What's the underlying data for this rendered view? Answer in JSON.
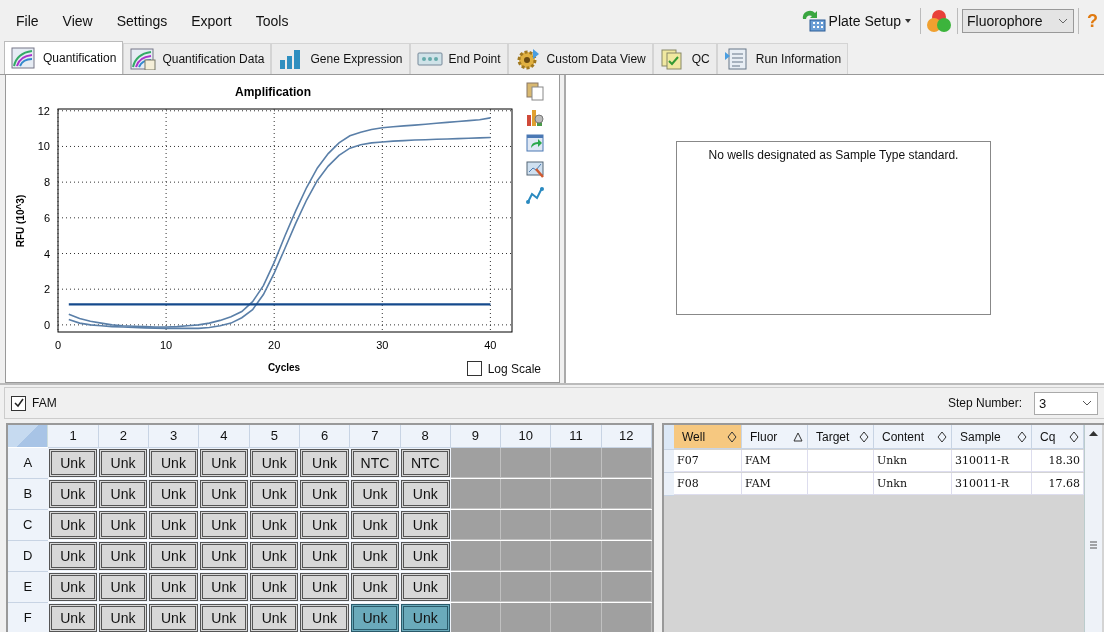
{
  "menu": [
    "File",
    "View",
    "Settings",
    "Export",
    "Tools"
  ],
  "toolbar": {
    "plate_setup": "Plate Setup",
    "fluorophore": "Fluorophore",
    "help": "?"
  },
  "tabs": [
    {
      "label": "Quantification",
      "selected": true
    },
    {
      "label": "Quantification Data",
      "selected": false
    },
    {
      "label": "Gene Expression",
      "selected": false
    },
    {
      "label": "End Point",
      "selected": false
    },
    {
      "label": "Custom Data View",
      "selected": false
    },
    {
      "label": "QC",
      "selected": false
    },
    {
      "label": "Run Information",
      "selected": false
    }
  ],
  "chart": {
    "log_scale": {
      "label": "Log Scale",
      "checked": false
    },
    "chart_data": {
      "type": "line",
      "title": "Amplification",
      "xlabel": "Cycles",
      "ylabel": "RFU (10^3)",
      "xlim": [
        0,
        42
      ],
      "ylim": [
        -0.4,
        12.1
      ],
      "xticks": [
        0,
        10,
        20,
        30,
        40
      ],
      "yticks": [
        0,
        2,
        4,
        6,
        8,
        10,
        12
      ],
      "x": [
        1,
        2,
        3,
        4,
        5,
        6,
        7,
        8,
        9,
        10,
        11,
        12,
        13,
        14,
        15,
        16,
        17,
        18,
        19,
        20,
        21,
        22,
        23,
        24,
        25,
        26,
        27,
        28,
        29,
        30,
        31,
        32,
        33,
        34,
        35,
        36,
        37,
        38,
        39,
        40
      ],
      "series": [
        {
          "color": "#5a7fa8",
          "values": [
            0.6,
            0.35,
            0.2,
            0.1,
            0.0,
            -0.05,
            -0.08,
            -0.1,
            -0.12,
            -0.12,
            -0.1,
            -0.05,
            0.0,
            0.1,
            0.25,
            0.45,
            0.75,
            1.3,
            2.2,
            3.5,
            5.0,
            6.4,
            7.7,
            8.8,
            9.6,
            10.2,
            10.6,
            10.8,
            10.95,
            11.05,
            11.1,
            11.15,
            11.2,
            11.25,
            11.3,
            11.35,
            11.4,
            11.45,
            11.5,
            11.6
          ]
        },
        {
          "color": "#5a7fa8",
          "values": [
            0.3,
            0.1,
            0.0,
            -0.05,
            -0.1,
            -0.12,
            -0.15,
            -0.17,
            -0.18,
            -0.2,
            -0.2,
            -0.2,
            -0.2,
            -0.15,
            -0.05,
            0.1,
            0.4,
            0.85,
            1.7,
            2.9,
            4.3,
            5.7,
            7.0,
            8.1,
            8.9,
            9.5,
            9.9,
            10.1,
            10.2,
            10.25,
            10.3,
            10.33,
            10.36,
            10.38,
            10.4,
            10.42,
            10.44,
            10.46,
            10.48,
            10.5
          ]
        },
        {
          "color": "#154a8c",
          "values": [
            1.15,
            1.15,
            1.15,
            1.15,
            1.15,
            1.15,
            1.15,
            1.15,
            1.15,
            1.15,
            1.15,
            1.15,
            1.15,
            1.15,
            1.15,
            1.15,
            1.15,
            1.15,
            1.15,
            1.15,
            1.15,
            1.15,
            1.15,
            1.15,
            1.15,
            1.15,
            1.15,
            1.15,
            1.15,
            1.15,
            1.15,
            1.15,
            1.15,
            1.15,
            1.15,
            1.15,
            1.15,
            1.15,
            1.15,
            1.15
          ]
        }
      ],
      "grid": true
    }
  },
  "standard_panel": {
    "message": "No wells designated as Sample Type standard."
  },
  "fluor_bar": {
    "label": "FAM",
    "checked": true,
    "step_label": "Step Number:",
    "step_value": "3"
  },
  "plate": {
    "columns": [
      "1",
      "2",
      "3",
      "4",
      "5",
      "6",
      "7",
      "8",
      "9",
      "10",
      "11",
      "12"
    ],
    "rows": [
      {
        "label": "A",
        "wells": [
          {
            "text": "Unk",
            "selected": false
          },
          {
            "text": "Unk",
            "selected": false
          },
          {
            "text": "Unk",
            "selected": false
          },
          {
            "text": "Unk",
            "selected": false
          },
          {
            "text": "Unk",
            "selected": false
          },
          {
            "text": "Unk",
            "selected": false
          },
          {
            "text": "NTC",
            "selected": false
          },
          {
            "text": "NTC",
            "selected": false
          }
        ]
      },
      {
        "label": "B",
        "wells": [
          {
            "text": "Unk",
            "selected": false
          },
          {
            "text": "Unk",
            "selected": false
          },
          {
            "text": "Unk",
            "selected": false
          },
          {
            "text": "Unk",
            "selected": false
          },
          {
            "text": "Unk",
            "selected": false
          },
          {
            "text": "Unk",
            "selected": false
          },
          {
            "text": "Unk",
            "selected": false
          },
          {
            "text": "Unk",
            "selected": false
          }
        ]
      },
      {
        "label": "C",
        "wells": [
          {
            "text": "Unk",
            "selected": false
          },
          {
            "text": "Unk",
            "selected": false
          },
          {
            "text": "Unk",
            "selected": false
          },
          {
            "text": "Unk",
            "selected": false
          },
          {
            "text": "Unk",
            "selected": false
          },
          {
            "text": "Unk",
            "selected": false
          },
          {
            "text": "Unk",
            "selected": false
          },
          {
            "text": "Unk",
            "selected": false
          }
        ]
      },
      {
        "label": "D",
        "wells": [
          {
            "text": "Unk",
            "selected": false
          },
          {
            "text": "Unk",
            "selected": false
          },
          {
            "text": "Unk",
            "selected": false
          },
          {
            "text": "Unk",
            "selected": false
          },
          {
            "text": "Unk",
            "selected": false
          },
          {
            "text": "Unk",
            "selected": false
          },
          {
            "text": "Unk",
            "selected": false
          },
          {
            "text": "Unk",
            "selected": false
          }
        ]
      },
      {
        "label": "E",
        "wells": [
          {
            "text": "Unk",
            "selected": false
          },
          {
            "text": "Unk",
            "selected": false
          },
          {
            "text": "Unk",
            "selected": false
          },
          {
            "text": "Unk",
            "selected": false
          },
          {
            "text": "Unk",
            "selected": false
          },
          {
            "text": "Unk",
            "selected": false
          },
          {
            "text": "Unk",
            "selected": false
          },
          {
            "text": "Unk",
            "selected": false
          }
        ]
      },
      {
        "label": "F",
        "wells": [
          {
            "text": "Unk",
            "selected": false
          },
          {
            "text": "Unk",
            "selected": false
          },
          {
            "text": "Unk",
            "selected": false
          },
          {
            "text": "Unk",
            "selected": false
          },
          {
            "text": "Unk",
            "selected": false
          },
          {
            "text": "Unk",
            "selected": false
          },
          {
            "text": "Unk",
            "selected": true
          },
          {
            "text": "Unk",
            "selected": true
          }
        ]
      }
    ]
  },
  "table": {
    "columns": [
      {
        "label": "Well",
        "sorted": false,
        "selected": true
      },
      {
        "label": "Fluor",
        "sorted": true,
        "selected": false
      },
      {
        "label": "Target",
        "sorted": false,
        "selected": false
      },
      {
        "label": "Content",
        "sorted": false,
        "selected": false
      },
      {
        "label": "Sample",
        "sorted": false,
        "selected": false
      },
      {
        "label": "Cq",
        "sorted": false,
        "selected": false
      }
    ],
    "rows": [
      {
        "cells": [
          "F07",
          "FAM",
          null,
          "Unkn",
          "310011-R",
          "18.30"
        ]
      },
      {
        "cells": [
          "F08",
          "FAM",
          null,
          "Unkn",
          "310011-R",
          "17.68"
        ]
      }
    ]
  }
}
